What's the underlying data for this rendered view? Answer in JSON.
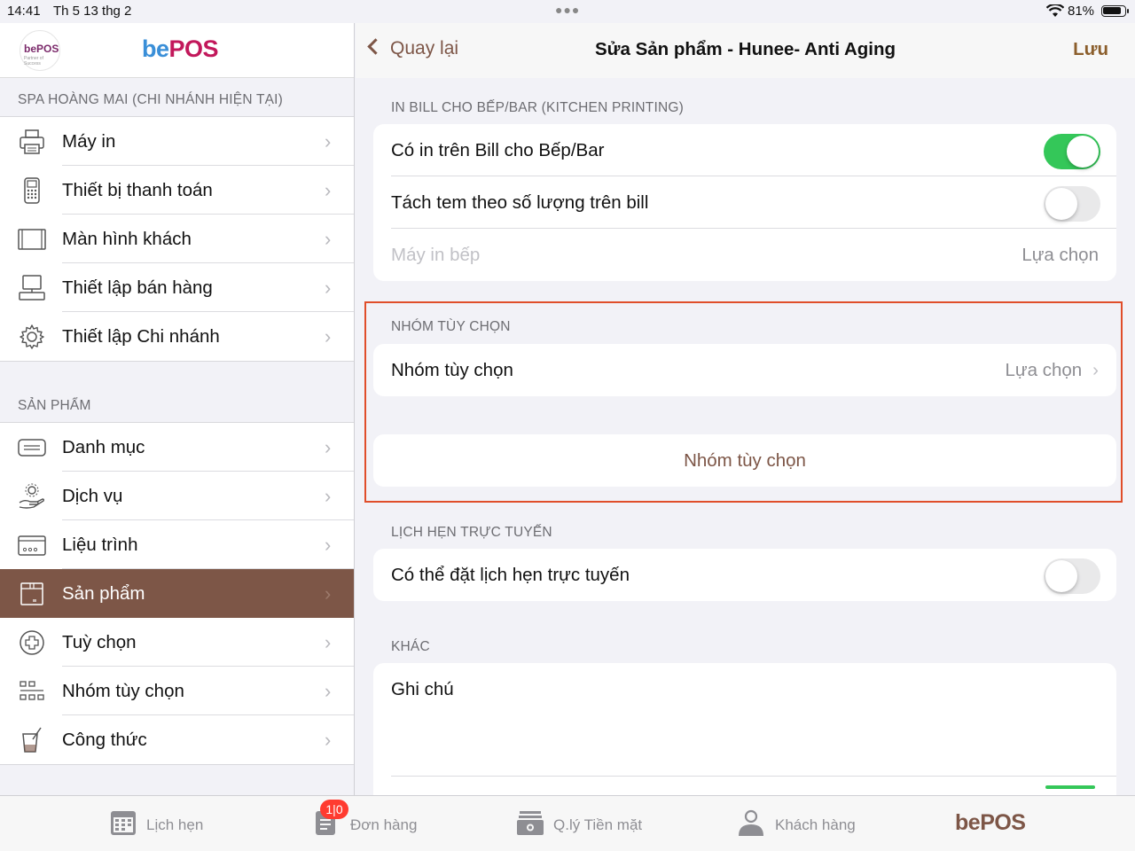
{
  "status": {
    "time": "14:41",
    "date": "Th 5 13 thg 2",
    "battery": "81%"
  },
  "brand": {
    "logo_text": "bePOS",
    "logo_sub": "Partner of Success",
    "name_be": "be",
    "name_pos": "POS"
  },
  "sidebar": {
    "branch_header": "SPA HOÀNG MAI  (CHI NHÁNH HIỆN TẠI)",
    "branch_items": [
      {
        "label": "Máy in",
        "icon": "printer-icon"
      },
      {
        "label": "Thiết bị thanh toán",
        "icon": "payment-terminal-icon"
      },
      {
        "label": "Màn hình khách",
        "icon": "customer-display-icon"
      },
      {
        "label": "Thiết lập bán hàng",
        "icon": "pos-terminal-icon"
      },
      {
        "label": "Thiết lập Chi nhánh",
        "icon": "gear-icon"
      }
    ],
    "product_header": "SẢN PHẨM",
    "product_items": [
      {
        "label": "Danh mục",
        "icon": "category-icon"
      },
      {
        "label": "Dịch vụ",
        "icon": "service-icon"
      },
      {
        "label": "Liệu trình",
        "icon": "treatment-card-icon"
      },
      {
        "label": "Sản phẩm",
        "icon": "product-box-icon",
        "active": true
      },
      {
        "label": "Tuỳ chọn",
        "icon": "plus-circle-icon"
      },
      {
        "label": "Nhóm tùy chọn",
        "icon": "option-group-icon"
      },
      {
        "label": "Công thức",
        "icon": "recipe-icon"
      }
    ],
    "chevron": "›"
  },
  "navbar": {
    "back_label": "Quay lại",
    "title": "Sửa Sản phẩm - Hunee- Anti Aging",
    "save_label": "Lưu"
  },
  "kitchen": {
    "header": "IN BILL CHO BẾP/BAR (KITCHEN PRINTING)",
    "print_on_bill_label": "Có in trên Bill cho Bếp/Bar",
    "print_on_bill_on": true,
    "split_label": "Tách tem theo số lượng trên bill",
    "split_on": false,
    "printer_label": "Máy in bếp",
    "printer_value": "Lựa chọn"
  },
  "option_group": {
    "header": "NHÓM TÙY CHỌN",
    "row_label": "Nhóm tùy chọn",
    "row_value": "Lựa chọn",
    "row_chevron": "›",
    "button_label": "Nhóm tùy chọn"
  },
  "online_booking": {
    "header": "LỊCH HẸN TRỰC TUYẾN",
    "label": "Có thể đặt lịch hẹn trực tuyến",
    "on": false
  },
  "other": {
    "header": "KHÁC",
    "note_label": "Ghi chú"
  },
  "tabbar": {
    "tabs": [
      {
        "label": "Lịch hẹn",
        "icon": "calendar-icon"
      },
      {
        "label": "Đơn hàng",
        "icon": "order-icon",
        "badge": "1|0"
      },
      {
        "label": "Q.lý Tiền mặt",
        "icon": "cash-register-icon"
      },
      {
        "label": "Khách hàng",
        "icon": "person-icon"
      }
    ],
    "logo_be": "be",
    "logo_pos": "POS"
  },
  "colors": {
    "accent": "#7d5647",
    "highlight_border": "#e04e2a",
    "toggle_on": "#34c759",
    "badge": "#ff3b30"
  }
}
